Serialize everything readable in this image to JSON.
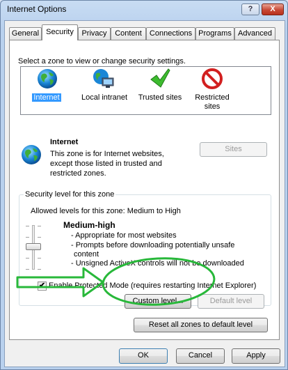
{
  "window": {
    "title": "Internet Options",
    "help_glyph": "?",
    "close_glyph": "X"
  },
  "tabs": [
    "General",
    "Security",
    "Privacy",
    "Content",
    "Connections",
    "Programs",
    "Advanced"
  ],
  "active_tab": "Security",
  "zone_prompt": "Select a zone to view or change security settings.",
  "zones": [
    {
      "label": "Internet",
      "icon": "globe-icon"
    },
    {
      "label": "Local intranet",
      "icon": "intranet-icon"
    },
    {
      "label": "Trusted sites",
      "icon": "checkmark-icon"
    },
    {
      "label_line1": "Restricted",
      "label_line2": "sites",
      "icon": "restricted-icon"
    }
  ],
  "selected_zone": "Internet",
  "zone_detail": {
    "name": "Internet",
    "description_lines": [
      "This zone is for Internet websites,",
      "except those listed in trusted and",
      "restricted zones."
    ],
    "sites_button": "Sites"
  },
  "security_level": {
    "group_label": "Security level for this zone",
    "allowed_levels": "Allowed levels for this zone: Medium to High",
    "level_name": "Medium-high",
    "bullets": [
      "- Appropriate for most websites",
      "- Prompts before downloading potentially unsafe",
      "  content",
      "- Unsigned ActiveX controls will not be downloaded"
    ],
    "slider_level": "Medium-high"
  },
  "protected_mode": {
    "label": "Enable Protected Mode (requires restarting Internet Explorer)",
    "checked": true,
    "check_glyph": "✔"
  },
  "buttons": {
    "custom_level": "Custom level...",
    "default_level": "Default level",
    "reset_all": "Reset all zones to default level",
    "ok": "OK",
    "cancel": "Cancel",
    "apply": "Apply"
  },
  "colors": {
    "selection": "#3399ff",
    "annotation_green": "#28b83a"
  }
}
